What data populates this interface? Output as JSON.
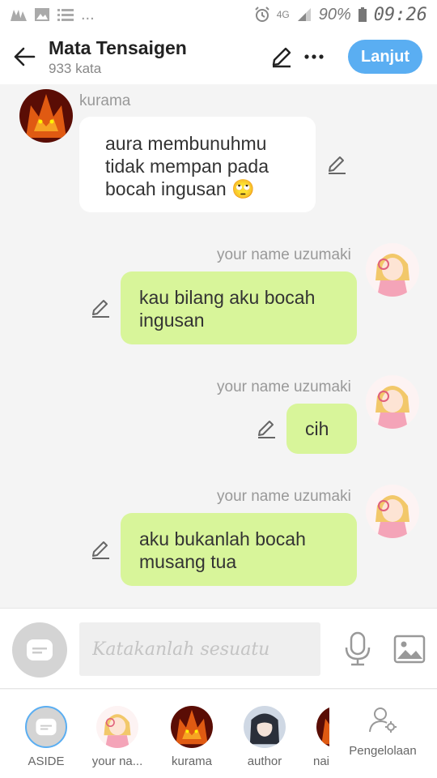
{
  "status_bar": {
    "battery": "90%",
    "time": "09:26",
    "network": "4G",
    "ellipsis": "..."
  },
  "header": {
    "title": "Mata Tensaigen",
    "word_count": "933 kata",
    "next_label": "Lanjut"
  },
  "messages": [
    {
      "sender": "kurama",
      "lines": [
        "aura membunuhmu",
        "tidak mempan pada",
        "bocah ingusan 🙄"
      ],
      "side": "left"
    },
    {
      "sender": "your name uzumaki",
      "lines": [
        "kau bilang aku bocah",
        "ingusan"
      ],
      "side": "right"
    },
    {
      "sender": "your name uzumaki",
      "lines": [
        "cih"
      ],
      "side": "right"
    },
    {
      "sender": "your name uzumaki",
      "lines": [
        "aku bukanlah bocah",
        "musang tua"
      ],
      "side": "right"
    }
  ],
  "composer": {
    "placeholder": "Katakanlah sesuatu"
  },
  "characters": [
    {
      "label": "ASIDE"
    },
    {
      "label": "your na..."
    },
    {
      "label": "kurama"
    },
    {
      "label": "author"
    },
    {
      "label": "nai"
    }
  ],
  "manage_label": "Pengelolaan",
  "colors": {
    "accent": "#5aaef2",
    "outgoing_bubble": "#d8f59a",
    "incoming_bubble": "#ffffff",
    "background": "#f4f4f4"
  }
}
